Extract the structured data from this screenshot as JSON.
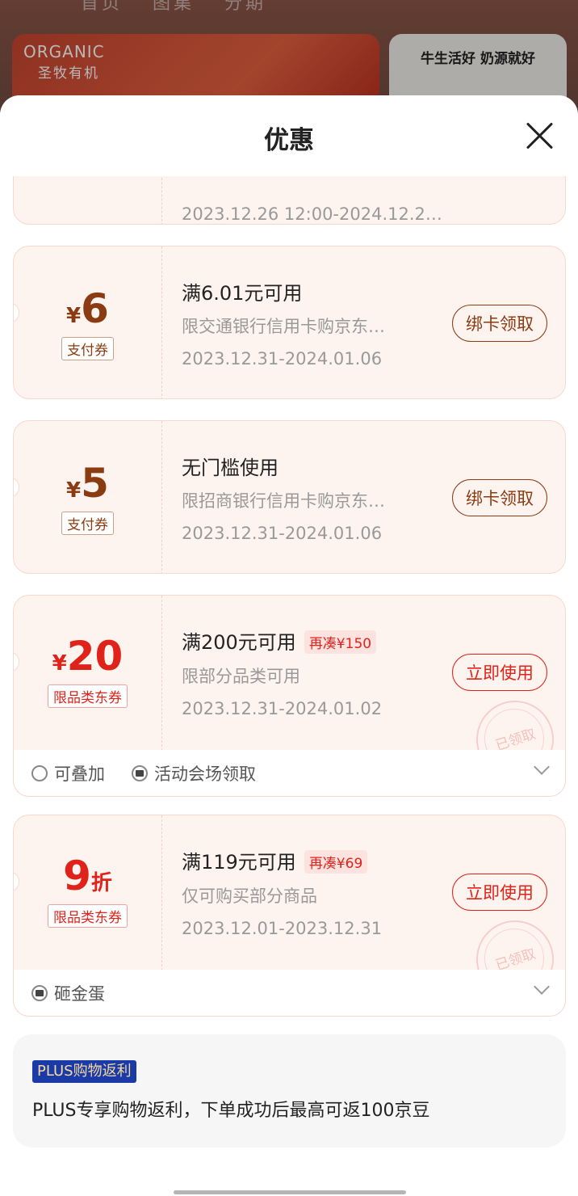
{
  "background": {
    "tabs": [
      "首页",
      "图集",
      "分期"
    ],
    "brand_en": "ORGANIC",
    "brand_cn": "圣牧有机",
    "slogan": "牛生活好 奶源就好"
  },
  "sheet": {
    "title": "优惠"
  },
  "partial_coupon": {
    "period": "2023.12.26 12:00-2024.12.2…"
  },
  "coupons": [
    {
      "yen": "¥",
      "amount": "6",
      "unit": "",
      "tag": "支付券",
      "condition": "满6.01元可用",
      "extra": "",
      "desc": "限交通银行信用卡购京东…",
      "period": "2023.12.31-2024.01.06",
      "button": "绑卡领取"
    },
    {
      "yen": "¥",
      "amount": "5",
      "unit": "",
      "tag": "支付券",
      "condition": "无门槛使用",
      "extra": "",
      "desc": "限招商银行信用卡购京东…",
      "period": "2023.12.31-2024.01.06",
      "button": "绑卡领取"
    },
    {
      "yen": "¥",
      "amount": "20",
      "unit": "",
      "tag": "限品类东券",
      "condition": "满200元可用",
      "extra": "再凑¥150",
      "desc": "限部分品类可用",
      "period": "2023.12.31-2024.01.02",
      "button": "立即使用",
      "stamp": "已领取",
      "footer": [
        "可叠加",
        "活动会场领取"
      ]
    },
    {
      "yen": "",
      "amount": "9",
      "unit": "折",
      "tag": "限品类东券",
      "condition": "满119元可用",
      "extra": "再凑¥69",
      "desc": "仅可购买部分商品",
      "period": "2023.12.01-2023.12.31",
      "button": "立即使用",
      "stamp": "已领取",
      "footer": [
        "砸金蛋"
      ]
    }
  ],
  "plus": {
    "badge": "PLUS购物返利",
    "text": "PLUS专享购物返利，下单成功后最高可返100京豆"
  },
  "colors": {
    "brown": "#8a3b12",
    "red": "#e0231a",
    "plus_badge": "#1a3aa8"
  }
}
